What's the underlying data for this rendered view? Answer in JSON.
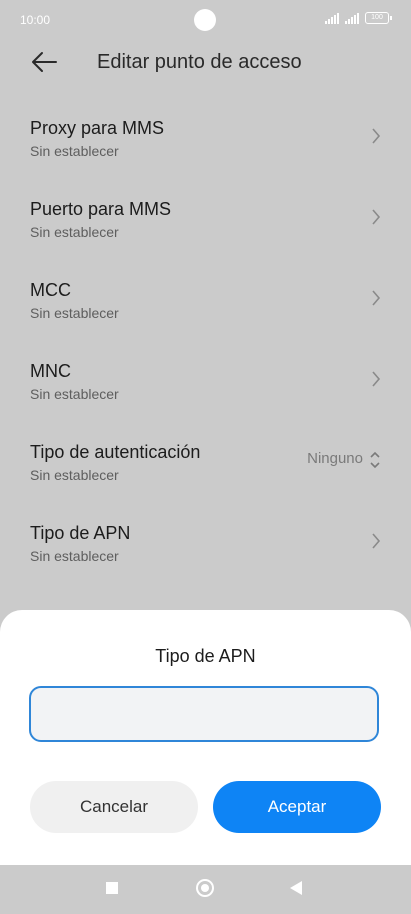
{
  "status": {
    "time": "10:00",
    "battery": "100"
  },
  "header": {
    "title": "Editar punto de acceso"
  },
  "items": [
    {
      "label": "Proxy para MMS",
      "sub": "Sin establecer"
    },
    {
      "label": "Puerto para MMS",
      "sub": "Sin establecer"
    },
    {
      "label": "MCC",
      "sub": "Sin establecer"
    },
    {
      "label": "MNC",
      "sub": "Sin establecer"
    },
    {
      "label": "Tipo de autenticación",
      "sub": "Sin establecer",
      "value": "Ninguno"
    },
    {
      "label": "Tipo de APN",
      "sub": "Sin establecer"
    }
  ],
  "dialog": {
    "title": "Tipo de APN",
    "input_value": "",
    "cancel_label": "Cancelar",
    "ok_label": "Aceptar"
  },
  "colors": {
    "accent": "#0e84f5",
    "focus_border": "#2f86d8",
    "overlay": "#cbcbcb"
  }
}
